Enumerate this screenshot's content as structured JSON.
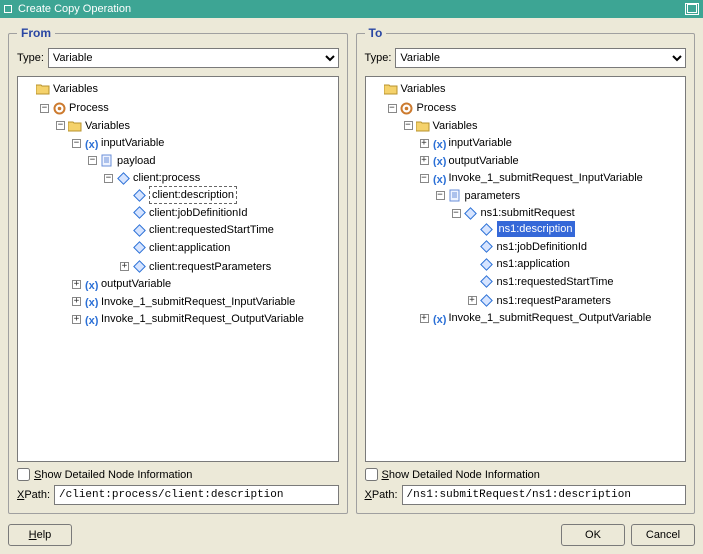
{
  "window": {
    "title": "Create Copy Operation"
  },
  "from": {
    "legend": "From",
    "type_label": "Type:",
    "type_value": "Variable",
    "show_detailed_label": "Show Detailed Node Information",
    "xpath_label": "XPath:",
    "xpath_value": "/client:process/client:description",
    "tree": {
      "root": "Variables",
      "process": "Process",
      "variables2": "Variables",
      "inputVariable": "inputVariable",
      "payload": "payload",
      "client_process": "client:process",
      "client_description": "client:description",
      "client_jobDefinitionId": "client:jobDefinitionId",
      "client_requestedStartTime": "client:requestedStartTime",
      "client_application": "client:application",
      "client_requestParameters": "client:requestParameters",
      "outputVariable": "outputVariable",
      "invoke_in": "Invoke_1_submitRequest_InputVariable",
      "invoke_out": "Invoke_1_submitRequest_OutputVariable"
    }
  },
  "to": {
    "legend": "To",
    "type_label": "Type:",
    "type_value": "Variable",
    "show_detailed_label": "Show Detailed Node Information",
    "xpath_label": "XPath:",
    "xpath_value": "/ns1:submitRequest/ns1:description",
    "tree": {
      "root": "Variables",
      "process": "Process",
      "variables2": "Variables",
      "inputVariable": "inputVariable",
      "outputVariable": "outputVariable",
      "invoke_in": "Invoke_1_submitRequest_InputVariable",
      "parameters": "parameters",
      "ns1_submitRequest": "ns1:submitRequest",
      "ns1_description": "ns1:description",
      "ns1_jobDefinitionId": "ns1:jobDefinitionId",
      "ns1_application": "ns1:application",
      "ns1_requestedStartTime": "ns1:requestedStartTime",
      "ns1_requestParameters": "ns1:requestParameters",
      "invoke_out": "Invoke_1_submitRequest_OutputVariable"
    }
  },
  "buttons": {
    "help": "Help",
    "ok": "OK",
    "cancel": "Cancel"
  }
}
